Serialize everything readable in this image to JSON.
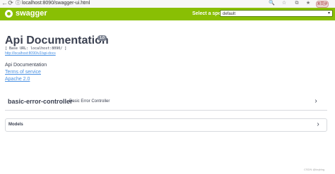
{
  "browser": {
    "back_icon": "←",
    "reload_icon": "⟳",
    "url": "ⓘ localhost:8090/swagger-ui.html",
    "zoom_icon": "🔍",
    "star_icon": "☆",
    "tab_icon": "⧉",
    "favorites_icon": "★",
    "profile_label": "未同步"
  },
  "topbar": {
    "brand": "swagger",
    "spec_label": "Select a spec",
    "spec_value": "default",
    "spec_caret": "▾"
  },
  "info": {
    "title": "Api Documentation",
    "version": "1.0",
    "base_url": "[ Base URL: localhost:8090/ ]",
    "docs_url": "http://localhost:8090/v2/api-docs",
    "description": "Api Documentation",
    "terms": "Terms of service",
    "license": "Apache 2.0"
  },
  "tags": [
    {
      "name": "basic-error-controller",
      "description": "Basic Error Controller",
      "chevron": "›"
    }
  ],
  "models": {
    "title": "Models",
    "chevron": "›"
  },
  "watermark": "CSDN @lzqbing"
}
